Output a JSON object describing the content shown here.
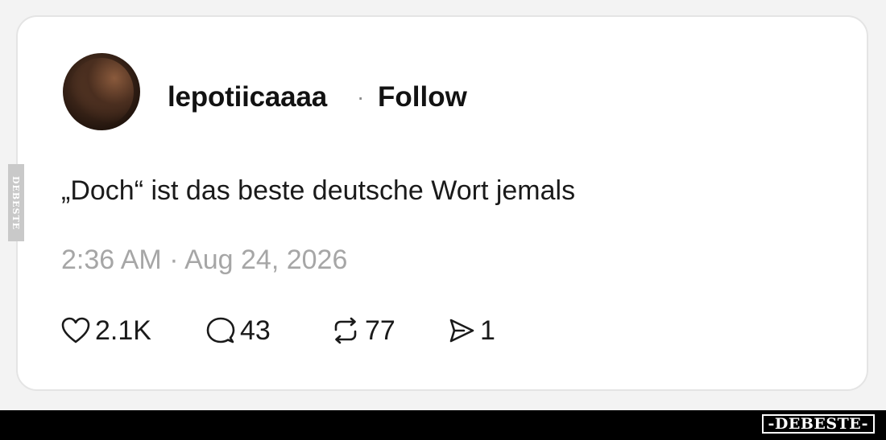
{
  "post": {
    "username": "lepotiicaaaa",
    "separator": "·",
    "follow_label": "Follow",
    "text": "„Doch“ ist das beste deutsche Wort jemals",
    "timestamp": "2:36 AM · Aug 24, 2026",
    "actions": {
      "likes": "2.1K",
      "replies": "43",
      "reposts": "77",
      "shares": "1"
    }
  },
  "watermark": {
    "side_text": "DEBESTE",
    "brand_text": "-DEBESTE-"
  },
  "icons": [
    "heart-icon",
    "comment-icon",
    "repost-icon",
    "send-icon"
  ]
}
